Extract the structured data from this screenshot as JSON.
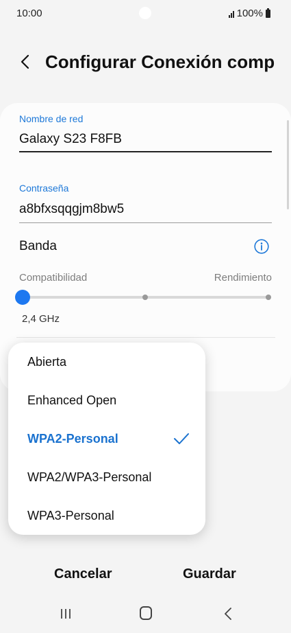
{
  "status_bar": {
    "time": "10:00",
    "battery": "100%",
    "icons": [
      "signal-icon",
      "battery-icon"
    ]
  },
  "header": {
    "title": "Configurar Conexión compa…",
    "back_icon": "chevron-left-icon"
  },
  "form": {
    "network_name": {
      "label": "Nombre de red",
      "value": "Galaxy S23 F8FB"
    },
    "password": {
      "label": "Contraseña",
      "value": "a8bfxsqqgjm8bw5"
    },
    "band": {
      "label": "Banda",
      "info_icon": "info-icon",
      "min_label": "Compatibilidad",
      "max_label": "Rendimiento",
      "selected_step": 0,
      "step_count": 3,
      "value": "2,4 GHz"
    }
  },
  "security_dropdown": {
    "options": [
      "Abierta",
      "Enhanced Open",
      "WPA2-Personal",
      "WPA2/WPA3-Personal",
      "WPA3-Personal"
    ],
    "selected": "WPA2-Personal",
    "check_icon": "check-icon"
  },
  "actions": {
    "cancel": "Cancelar",
    "save": "Guardar"
  },
  "nav_bar": {
    "icons": [
      "recents-icon",
      "home-icon",
      "back-icon"
    ]
  },
  "colors": {
    "accent": "#1d78f0",
    "label_blue": "#1d78d8",
    "background": "#f4f4f4",
    "card": "#fcfcfc"
  }
}
